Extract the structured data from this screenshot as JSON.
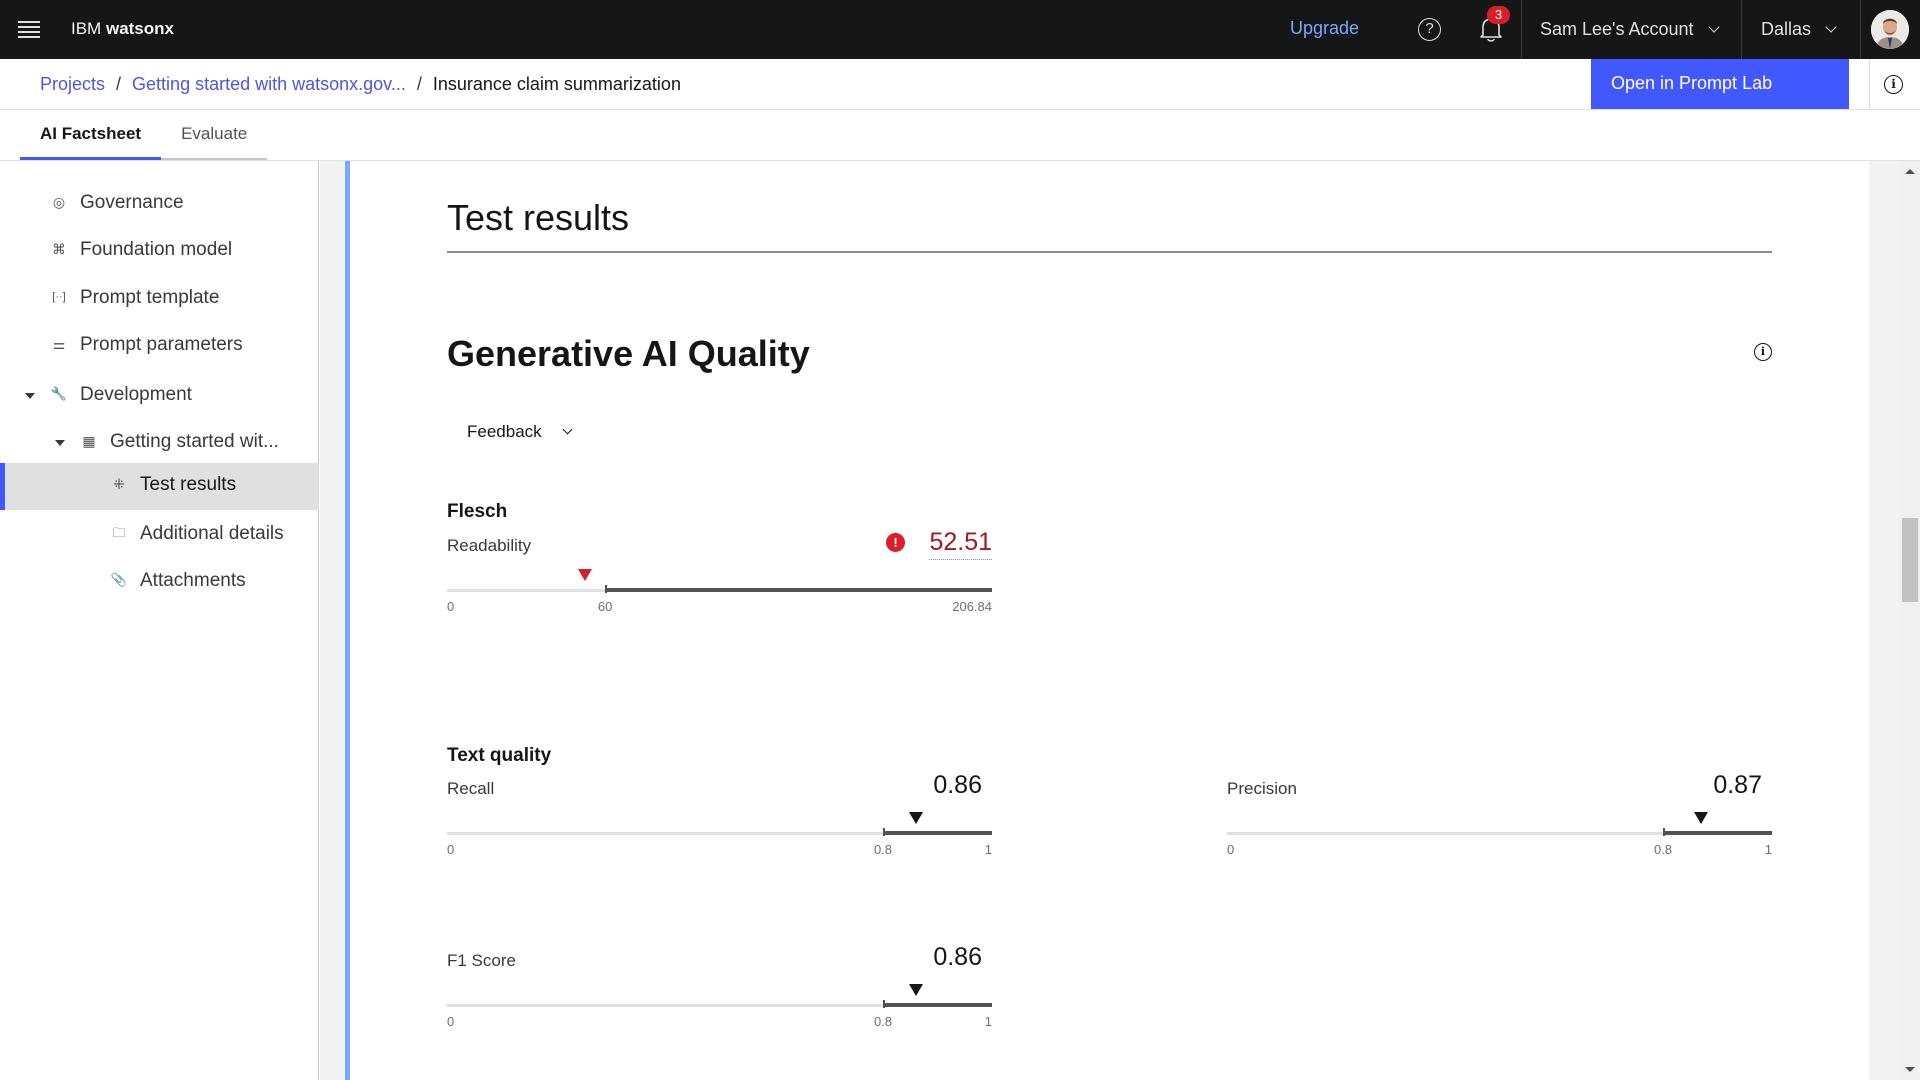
{
  "header": {
    "brand_prefix": "IBM",
    "brand_name": "watsonx",
    "upgrade_label": "Upgrade",
    "help_icon": "?",
    "notification_count": "3",
    "account_label": "Sam Lee's Account",
    "region_label": "Dallas"
  },
  "breadcrumb": {
    "items": [
      {
        "label": "Projects"
      },
      {
        "label": "Getting started with watsonx.gov..."
      }
    ],
    "separator": "/",
    "current": "Insurance claim summarization"
  },
  "actions": {
    "open_prompt_lab": "Open in Prompt Lab",
    "info_icon": "i"
  },
  "tabs": [
    {
      "label": "AI Factsheet",
      "active": true
    },
    {
      "label": "Evaluate",
      "active": false
    }
  ],
  "sidebar": {
    "items": [
      {
        "label": "Governance",
        "icon": "governance-icon",
        "glyph": "◎"
      },
      {
        "label": "Foundation model",
        "icon": "foundation-model-icon",
        "glyph": "⌘"
      },
      {
        "label": "Prompt template",
        "icon": "prompt-template-icon",
        "glyph": "[··]"
      },
      {
        "label": "Prompt parameters",
        "icon": "sliders-icon",
        "glyph": "⚌"
      },
      {
        "label": "Development",
        "icon": "wrench-icon",
        "glyph": "🔧",
        "expanded": true
      },
      {
        "label": "Getting started wit...",
        "icon": "app-grid-icon",
        "glyph": "▦",
        "expanded": true
      },
      {
        "label": "Test results",
        "icon": "test-results-icon",
        "glyph": "⁜",
        "selected": true
      },
      {
        "label": "Additional details",
        "icon": "folder-details-icon",
        "glyph": "🗀"
      },
      {
        "label": "Attachments",
        "icon": "paperclip-icon",
        "glyph": "📎"
      }
    ]
  },
  "main": {
    "title": "Test results",
    "section_title": "Generative AI Quality",
    "section_info_icon": "i",
    "dropdown": {
      "selected": "Feedback"
    },
    "groups": [
      {
        "title": "Flesch",
        "metrics": [
          {
            "label": "Readability",
            "value": "52.51",
            "value_num": 52.51,
            "status": "violation",
            "warn_glyph": "!",
            "min": 0,
            "threshold": 60,
            "max": 206.84,
            "ticks": [
              "0",
              "60",
              "206.84"
            ]
          }
        ]
      },
      {
        "title": "Text quality",
        "metrics": [
          {
            "label": "Recall",
            "value": "0.86",
            "value_num": 0.86,
            "status": "ok",
            "min": 0,
            "threshold": 0.8,
            "max": 1,
            "ticks": [
              "0",
              "0.8",
              "1"
            ]
          },
          {
            "label": "Precision",
            "value": "0.87",
            "value_num": 0.87,
            "status": "ok",
            "min": 0,
            "threshold": 0.8,
            "max": 1,
            "ticks": [
              "0",
              "0.8",
              "1"
            ]
          },
          {
            "label": "F1 Score",
            "value": "0.86",
            "value_num": 0.86,
            "status": "ok",
            "min": 0,
            "threshold": 0.8,
            "max": 1,
            "ticks": [
              "0",
              "0.8",
              "1"
            ]
          }
        ]
      }
    ]
  },
  "colors": {
    "header_bg": "#161616",
    "primary": "#4258ff",
    "link": "#4f55e0",
    "upgrade": "#78a9ff",
    "danger": "#da1e28",
    "danger_text": "#a2191f"
  }
}
